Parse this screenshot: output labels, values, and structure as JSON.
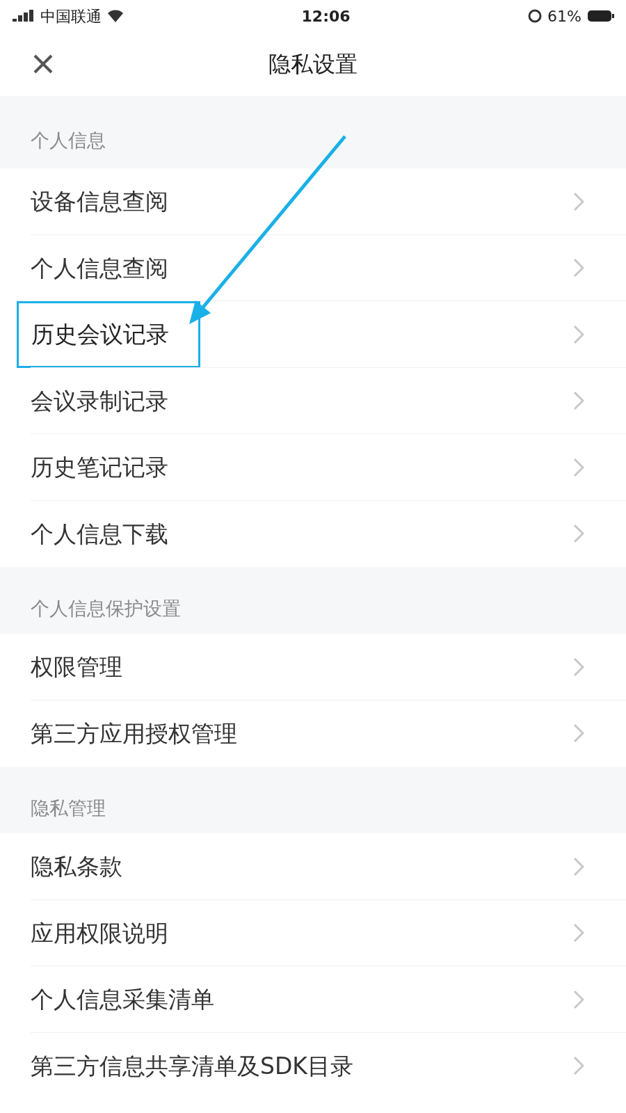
{
  "status_bar": {
    "carrier": "中国联通",
    "time": "12:06",
    "battery": "61%"
  },
  "nav": {
    "title": "隐私设置"
  },
  "sections": [
    {
      "header": "个人信息",
      "items": [
        {
          "label": "设备信息查阅",
          "highlighted": false
        },
        {
          "label": "个人信息查阅",
          "highlighted": false
        },
        {
          "label": "历史会议记录",
          "highlighted": true
        },
        {
          "label": "会议录制记录",
          "highlighted": false
        },
        {
          "label": "历史笔记记录",
          "highlighted": false
        },
        {
          "label": "个人信息下载",
          "highlighted": false
        }
      ]
    },
    {
      "header": "个人信息保护设置",
      "items": [
        {
          "label": "权限管理",
          "highlighted": false
        },
        {
          "label": "第三方应用授权管理",
          "highlighted": false
        }
      ]
    },
    {
      "header": "隐私管理",
      "items": [
        {
          "label": "隐私条款",
          "highlighted": false
        },
        {
          "label": "应用权限说明",
          "highlighted": false
        },
        {
          "label": "个人信息采集清单",
          "highlighted": false
        },
        {
          "label": "第三方信息共享清单及SDK目录",
          "highlighted": false
        }
      ]
    }
  ]
}
